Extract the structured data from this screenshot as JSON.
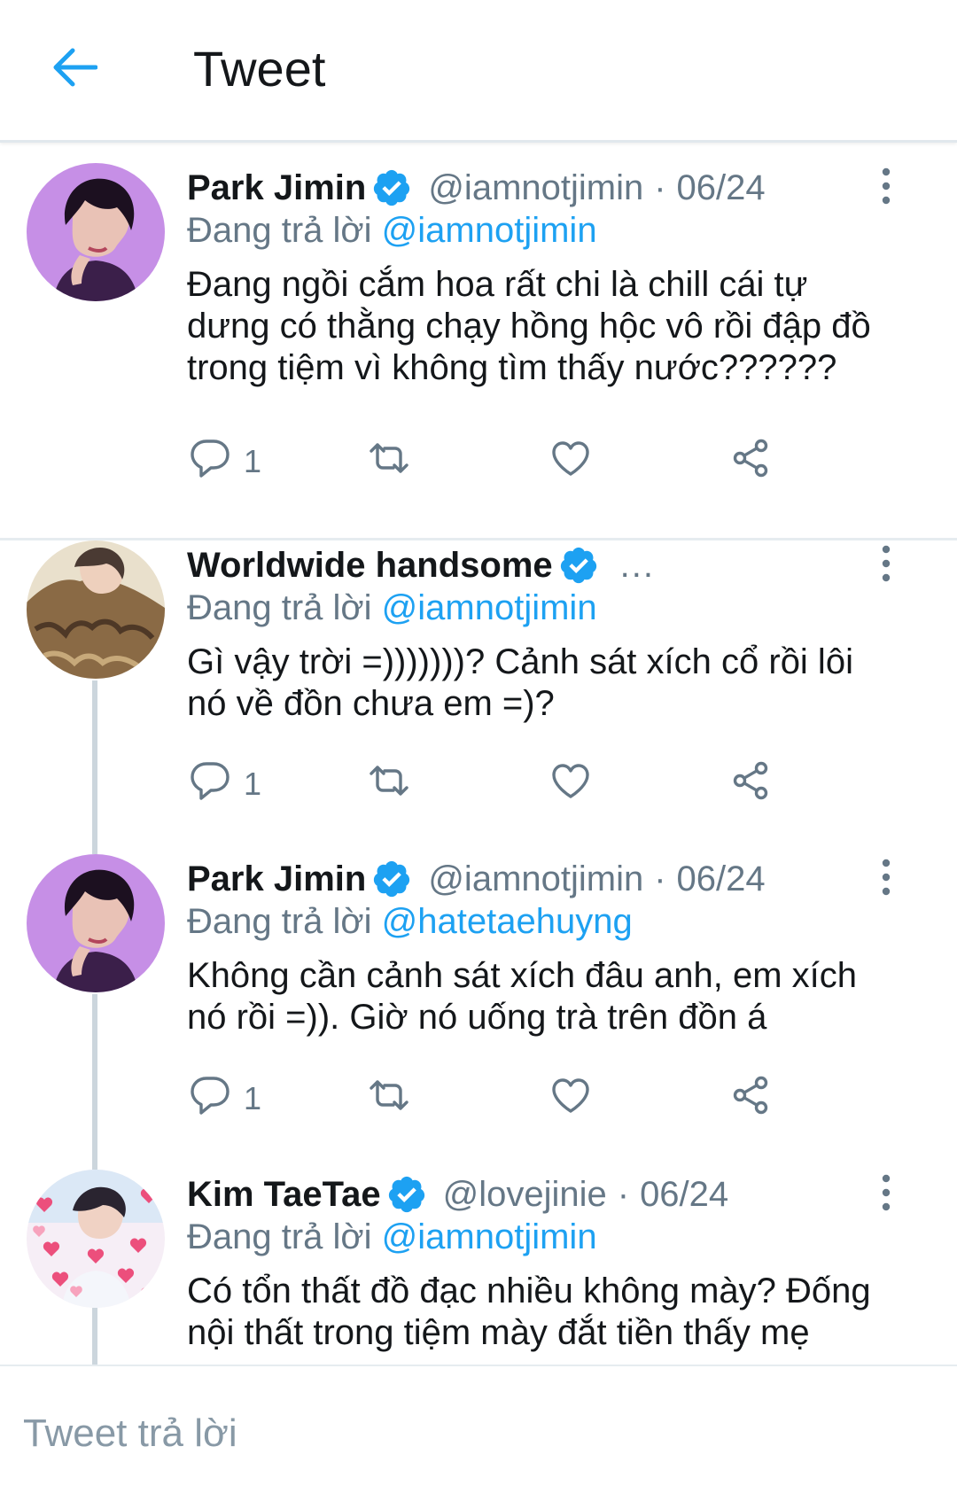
{
  "header": {
    "title": "Tweet"
  },
  "colors": {
    "accent": "#1da1f2",
    "secondary_text": "#657786",
    "thread_line": "#ccd6dd"
  },
  "tweets": [
    {
      "name": "Park Jimin",
      "handle": "@iamnotjimin",
      "separator": "·",
      "time": "06/24",
      "replying_label": "Đang trả lời",
      "replying_to": "@iamnotjimin",
      "text": "Đang ngồi cắm hoa rất chi là chill cái tự dưng có thằng chạy hồng hộc vô rồi đập đồ trong tiệm vì không tìm thấy nước??????",
      "reply_count": "1",
      "avatar_icon": "purple-avatar"
    },
    {
      "name": "Worldwide handsome",
      "handle_truncated": "...",
      "replying_label": "Đang trả lời",
      "replying_to": "@iamnotjimin",
      "text": "Gì vậy trời =)))))))? Cảnh sát xích cổ rồi lôi nó về đồn chưa em =)?",
      "reply_count": "1",
      "avatar_icon": "fur-coat-avatar"
    },
    {
      "name": "Park Jimin",
      "handle": "@iamnotjimin",
      "separator": "·",
      "time": "06/24",
      "replying_label": "Đang trả lời",
      "replying_to": "@hatetaehuyng",
      "text": "Không cần cảnh sát xích đâu anh, em xích nó rồi =)). Giờ nó uống trà trên đồn á",
      "reply_count": "1",
      "avatar_icon": "purple-avatar"
    },
    {
      "name": "Kim TaeTae",
      "handle": "@lovejinie",
      "separator": "·",
      "time": "06/24",
      "replying_label": "Đang trả lời",
      "replying_to": "@iamnotjimin",
      "text": "Có tổn thất đồ đạc nhiều không mày? Đống nội thất trong tiệm mày đắt tiền thấy mẹ",
      "avatar_icon": "hearts-avatar"
    }
  ],
  "reply_bar": {
    "placeholder": "Tweet trả lời"
  }
}
